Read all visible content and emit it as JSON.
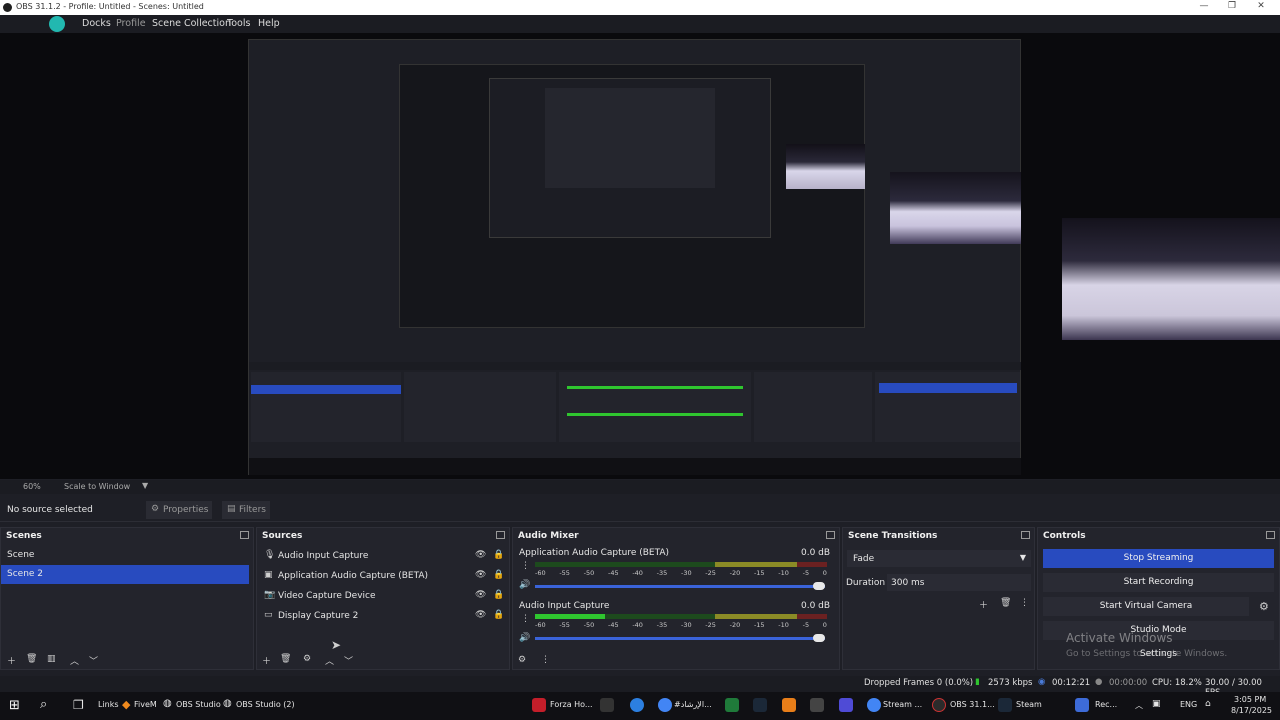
{
  "window": {
    "title": "OBS 31.1.2 - Profile: Untitled - Scenes: Untitled",
    "controls": [
      "—",
      "❐",
      "✕"
    ]
  },
  "menu": {
    "items": [
      "Docks",
      "Profile",
      "Scene Collection",
      "Tools",
      "Help"
    ]
  },
  "preview": {
    "zoom": "60%",
    "scale_mode": "Scale to Window"
  },
  "source_toolbar": {
    "selected_text": "No source selected",
    "properties_label": "Properties",
    "filters_label": "Filters"
  },
  "scenes": {
    "title": "Scenes",
    "items": [
      {
        "label": "Scene",
        "selected": false
      },
      {
        "label": "Scene 2",
        "selected": true
      }
    ]
  },
  "sources": {
    "title": "Sources",
    "items": [
      {
        "label": "Audio Input Capture",
        "icon": "microphone-icon"
      },
      {
        "label": "Application Audio Capture (BETA)",
        "icon": "app-audio-icon"
      },
      {
        "label": "Video Capture Device",
        "icon": "camera-icon"
      },
      {
        "label": "Display Capture 2",
        "icon": "display-icon"
      }
    ]
  },
  "audio_mixer": {
    "title": "Audio Mixer",
    "tick_labels": [
      "-60",
      "-55",
      "-50",
      "-45",
      "-40",
      "-35",
      "-30",
      "-25",
      "-20",
      "-15",
      "-10",
      "-5",
      "0"
    ],
    "channels": [
      {
        "name": "Application Audio Capture (BETA)",
        "db": "0.0 dB",
        "level": 0.0
      },
      {
        "name": "Audio Input Capture",
        "db": "0.0 dB",
        "level": 0.24
      }
    ]
  },
  "scene_transitions": {
    "title": "Scene Transitions",
    "transition": "Fade",
    "duration_label": "Duration",
    "duration_value": "300 ms"
  },
  "controls": {
    "title": "Controls",
    "stop_streaming": "Stop Streaming",
    "start_recording": "Start Recording",
    "start_virtual_camera": "Start Virtual Camera",
    "studio_mode": "Studio Mode",
    "settings": "Settings",
    "watermark_line1": "Activate Windows",
    "watermark_line2": "Go to Settings to activate Windows."
  },
  "status": {
    "dropped_frames": "Dropped Frames 0 (0.0%)",
    "bitrate": "2573 kbps",
    "stream_time": "00:12:21",
    "record_time": "00:00:00",
    "cpu": "CPU: 18.2%",
    "fps": "30.00 / 30.00 FPS"
  },
  "taskbar": {
    "links": "Links",
    "fivem": "FiveM",
    "obs1": "OBS Studio",
    "obs2": "OBS Studio (2)",
    "forza": "Forza Ho...",
    "arabic": "#الإرشاد...",
    "chrome_stream": "Stream ...",
    "obs_active": "OBS 31.1...",
    "steam": "Steam",
    "rec": "Rec...",
    "lang": "ENG",
    "time": "3:05 PM",
    "date": "8/17/2025"
  },
  "colors": {
    "accent": "#284bbf",
    "meter_green": "#2fc62f",
    "meter_yellow": "#8b8b26",
    "meter_red": "#6b2121"
  }
}
